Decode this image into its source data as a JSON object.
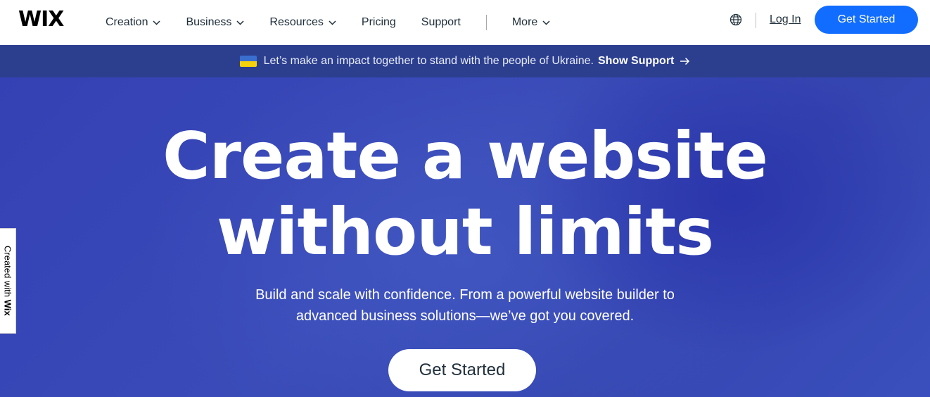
{
  "header": {
    "logo": "WIX",
    "nav": [
      {
        "label": "Creation",
        "dropdown": true
      },
      {
        "label": "Business",
        "dropdown": true
      },
      {
        "label": "Resources",
        "dropdown": true
      },
      {
        "label": "Pricing",
        "dropdown": false
      },
      {
        "label": "Support",
        "dropdown": false
      }
    ],
    "more_label": "More",
    "globe_icon": "globe-icon",
    "login_label": "Log In",
    "cta_label": "Get Started"
  },
  "banner": {
    "text": "Let’s make an impact together to stand with the people of Ukraine.",
    "link_label": "Show Support",
    "flag_icon": "ukraine-flag-icon",
    "arrow_icon": "arrow-right-icon"
  },
  "hero": {
    "title_line1": "Create a website",
    "title_line2": "without limits",
    "subtitle_line1": "Build and scale with confidence. From a powerful website builder to",
    "subtitle_line2": "advanced business solutions—we’ve got you covered.",
    "cta_label": "Get Started"
  },
  "side_tab": {
    "prefix": "Created with ",
    "brand": "Wix"
  },
  "colors": {
    "primary_button": "#116dff",
    "banner_bg": "#2c3f8f",
    "hero_bg": "#3441b4"
  }
}
